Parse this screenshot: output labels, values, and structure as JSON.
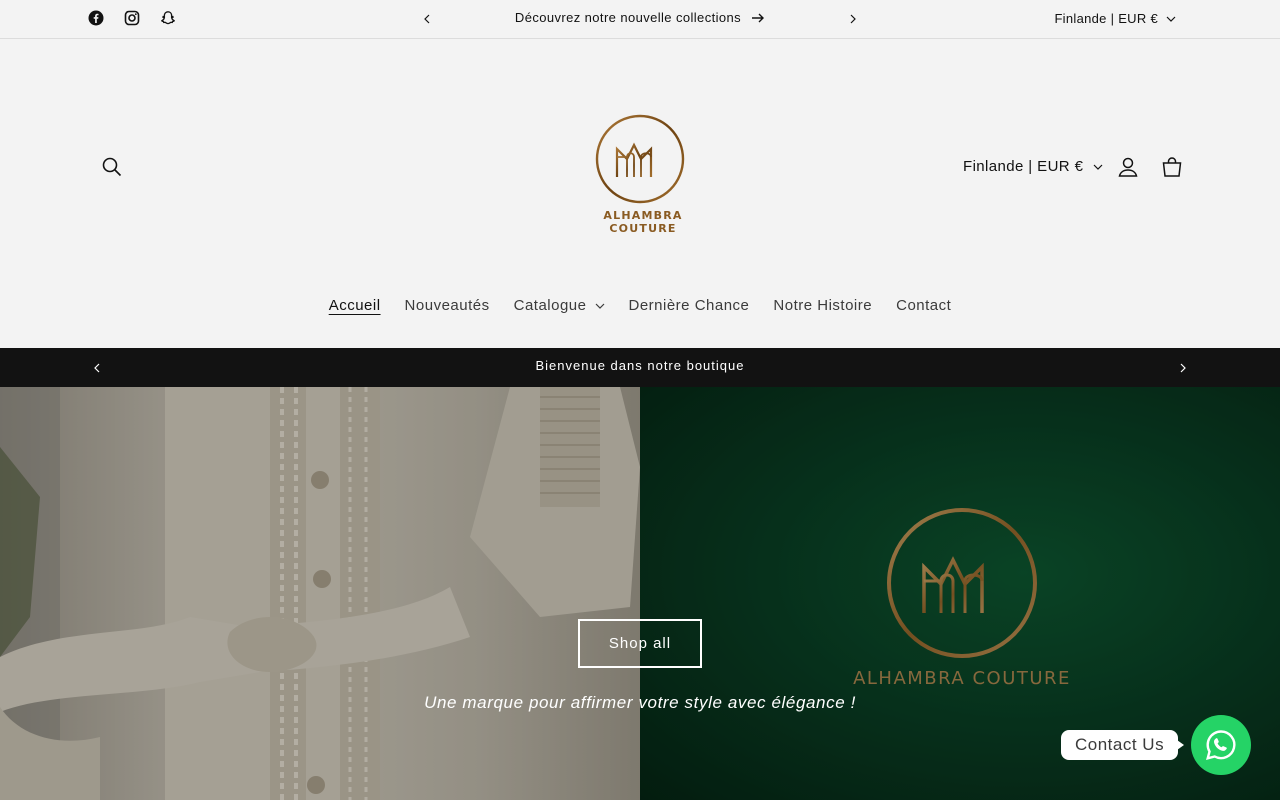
{
  "utility": {
    "socials": [
      "facebook-icon",
      "instagram-icon",
      "snapchat-icon"
    ],
    "announcement": "Découvrez notre nouvelle collections",
    "locale": "Finlande | EUR €"
  },
  "header": {
    "logo_text": "ALHAMBRA COUTURE",
    "locale": "Finlande | EUR €",
    "nav": [
      {
        "label": "Accueil"
      },
      {
        "label": "Nouveautés"
      },
      {
        "label": "Catalogue"
      },
      {
        "label": "Dernière Chance"
      },
      {
        "label": "Notre Histoire"
      },
      {
        "label": "Contact"
      }
    ]
  },
  "banner": {
    "text": "Bienvenue dans notre boutique"
  },
  "hero": {
    "logo_text": "ALHAMBRA COUTURE",
    "button_label": "Shop all",
    "tagline": "Une marque pour affirmer votre style avec élégance !"
  },
  "whatsapp": {
    "label": "Contact Us"
  },
  "colors": {
    "background": "#f3f3f3",
    "text": "#121212",
    "banner": "#121212",
    "whatsapp": "#25d366",
    "gold": "#8a5b22"
  }
}
